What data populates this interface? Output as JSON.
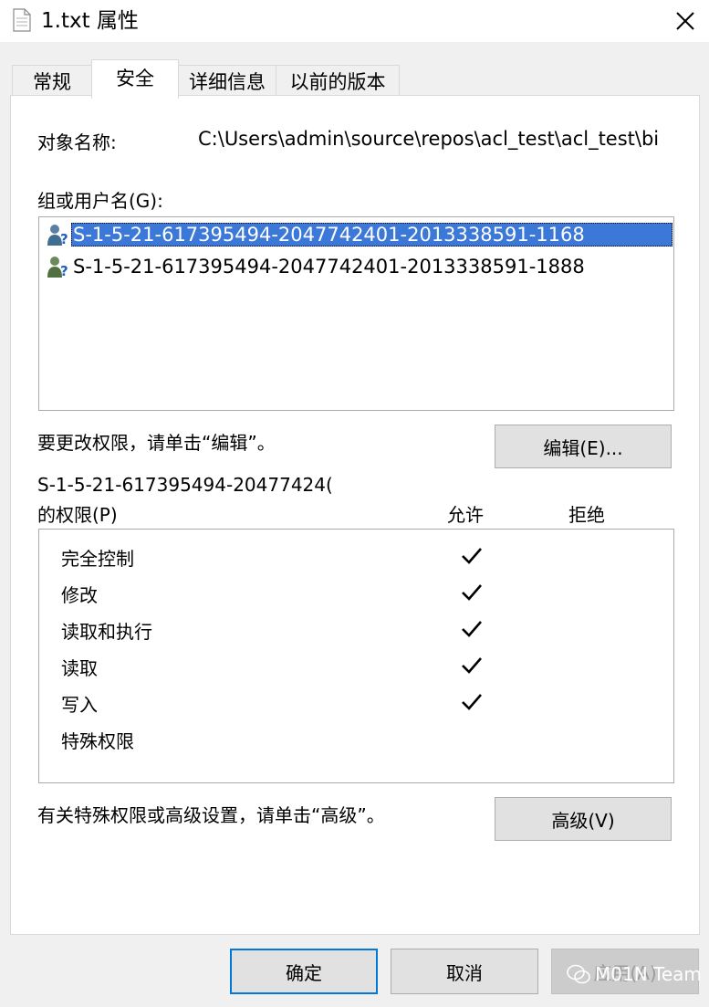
{
  "window": {
    "title": "1.txt 属性",
    "close_icon": "close-icon"
  },
  "tabs": [
    {
      "label": "常规",
      "active": false
    },
    {
      "label": "安全",
      "active": true
    },
    {
      "label": "详细信息",
      "active": false
    },
    {
      "label": "以前的版本",
      "active": false
    }
  ],
  "object": {
    "label": "对象名称:",
    "value": "C:\\Users\\admin\\source\\repos\\acl_test\\acl_test\\bi"
  },
  "groups": {
    "label": "组或用户名(G):",
    "items": [
      {
        "name": "S-1-5-21-617395494-2047742401-2013338591-1168",
        "selected": true,
        "icon": "unknown-user-icon"
      },
      {
        "name": "S-1-5-21-617395494-2047742401-2013338591-1888",
        "selected": false,
        "icon": "unknown-user-icon"
      }
    ]
  },
  "edit": {
    "hint": "要更改权限，请单击“编辑”。",
    "button": "编辑(E)..."
  },
  "permissions": {
    "title_line1": "S-1-5-21-617395494-20477424(",
    "title_line2": "的权限(P)",
    "allow_header": "允许",
    "deny_header": "拒绝",
    "rows": [
      {
        "name": "完全控制",
        "allow": true,
        "deny": false
      },
      {
        "name": "修改",
        "allow": true,
        "deny": false
      },
      {
        "name": "读取和执行",
        "allow": true,
        "deny": false
      },
      {
        "name": "读取",
        "allow": true,
        "deny": false
      },
      {
        "name": "写入",
        "allow": true,
        "deny": false
      },
      {
        "name": "特殊权限",
        "allow": false,
        "deny": false
      }
    ]
  },
  "advanced": {
    "hint": "有关特殊权限或高级设置，请单击“高级”。",
    "button": "高级(V)"
  },
  "footer": {
    "ok": "确定",
    "cancel": "取消",
    "apply": "应用(A)"
  },
  "watermark": {
    "text": "M01N Team",
    "icon": "wechat-icon"
  },
  "colors": {
    "selection": "#3c78d8",
    "accent_border": "#0078d7",
    "panel_bg": "#ffffff",
    "window_bg": "#f0f0f0"
  }
}
